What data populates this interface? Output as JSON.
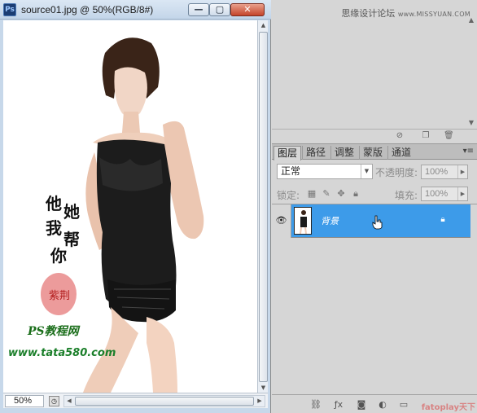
{
  "document": {
    "app_icon": "Ps",
    "title": "source01.jpg @ 50%(RGB/8#)",
    "window_buttons": {
      "minimize": "—",
      "maximize": "▢",
      "close": "✕"
    },
    "zoom": "50%",
    "canvas_text": {
      "calligraphy": [
        "他",
        "她",
        "我",
        "帮",
        "你"
      ],
      "seal": "紫荆",
      "brand": "PS教程网",
      "url": "www.tata580.com"
    }
  },
  "watermark_top": {
    "text": "思缘设计论坛",
    "site": "www.MISSYUAN.COM"
  },
  "layers_panel": {
    "tabs": [
      "图层",
      "路径",
      "调整",
      "蒙版",
      "通道"
    ],
    "active_tab": "图层",
    "blend_mode": "正常",
    "opacity_label": "不透明度:",
    "opacity_value": "100%",
    "lock_label": "锁定:",
    "fill_label": "填充:",
    "fill_value": "100%",
    "layers": [
      {
        "name": "背景",
        "locked": true,
        "visible": true,
        "selected": true
      }
    ],
    "selection_color": "#3d9be9"
  },
  "watermark_bottom": "fatoplay天下"
}
